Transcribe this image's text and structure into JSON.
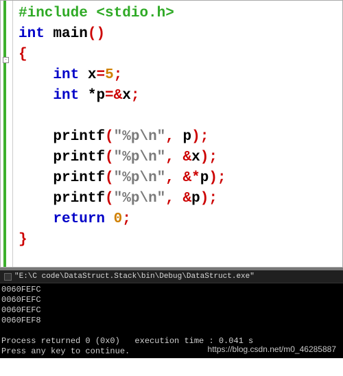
{
  "editor": {
    "fold_marker": "-",
    "code": {
      "l1": {
        "pp": "#include",
        "inc": " <stdio.h>"
      },
      "l2": {
        "kw": "int",
        "fn": " main",
        "paren_open": "(",
        "paren_close": ")"
      },
      "l3": {
        "brace": "{"
      },
      "l4": {
        "indent": "    ",
        "kw": "int",
        "txt": " x",
        "op": "=",
        "num": "5",
        "semi": ";"
      },
      "l5": {
        "indent": "    ",
        "kw": "int",
        "txt": " *p",
        "op": "=&",
        "var": "x",
        "semi": ";"
      },
      "l6": {
        "blank": ""
      },
      "l7": {
        "indent": "    ",
        "fn": "printf",
        "po": "(",
        "str": "\"%p\\n\"",
        "comma": ", ",
        "arg": "p",
        "pc": ")",
        "semi": ";"
      },
      "l8": {
        "indent": "    ",
        "fn": "printf",
        "po": "(",
        "str": "\"%p\\n\"",
        "comma": ", &",
        "arg": "x",
        "pc": ")",
        "semi": ";"
      },
      "l9": {
        "indent": "    ",
        "fn": "printf",
        "po": "(",
        "str": "\"%p\\n\"",
        "comma": ", &*",
        "arg": "p",
        "pc": ")",
        "semi": ";"
      },
      "l10": {
        "indent": "    ",
        "fn": "printf",
        "po": "(",
        "str": "\"%p\\n\"",
        "comma": ", &",
        "arg": "p",
        "pc": ")",
        "semi": ";"
      },
      "l11": {
        "indent": "    ",
        "kw": "return",
        "sp": " ",
        "num": "0",
        "semi": ";"
      },
      "l12": {
        "brace": "}"
      }
    }
  },
  "console": {
    "title": "\"E:\\C code\\DataStruct.Stack\\bin\\Debug\\DataStruct.exe\"",
    "lines": [
      "0060FEFC",
      "0060FEFC",
      "0060FEFC",
      "0060FEF8",
      "",
      "Process returned 0 (0x0)   execution time : 0.041 s",
      "Press any key to continue."
    ]
  },
  "watermark": "https://blog.csdn.net/m0_46285887"
}
